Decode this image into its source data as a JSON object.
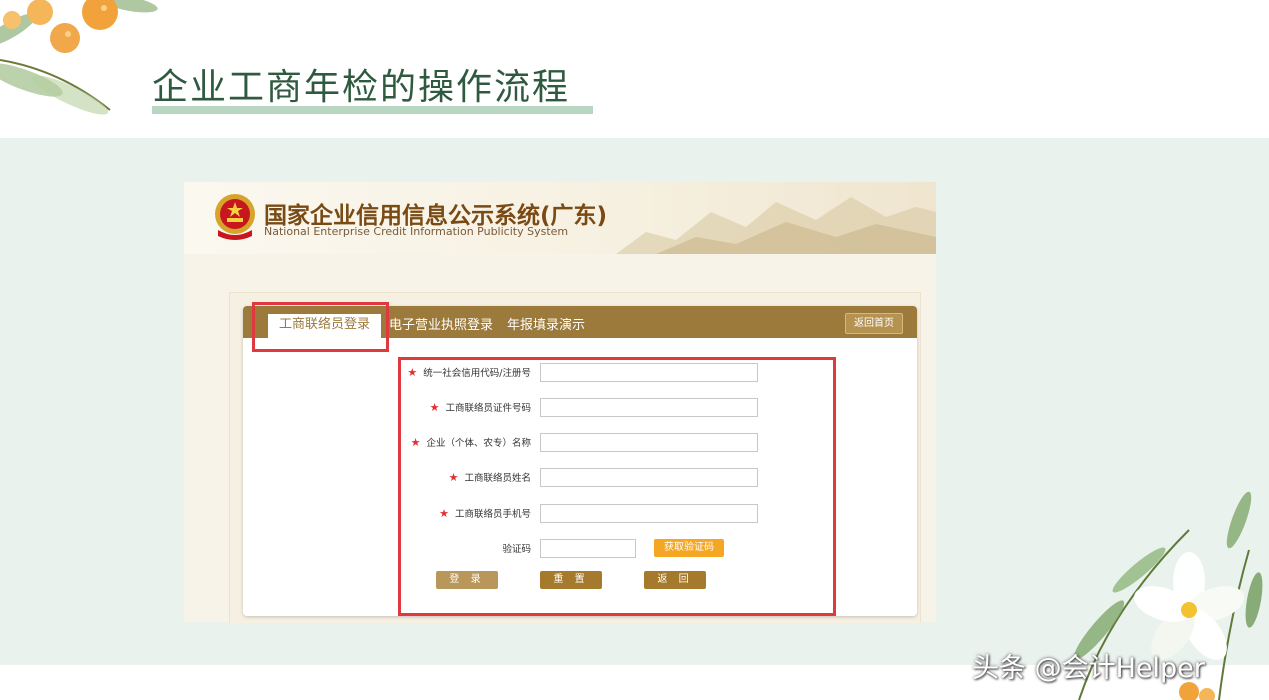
{
  "slide": {
    "title": "企业工商年检的操作流程",
    "watermark": "头条 @会计Helper"
  },
  "system": {
    "title": "国家企业信用信息公示系统(广东)",
    "subtitle": "National Enterprise Credit Information Publicity System",
    "emblem_icon": "national-emblem-icon"
  },
  "tabs": [
    {
      "label": "工商联络员登录",
      "active": true
    },
    {
      "label": "电子营业执照登录",
      "active": false
    },
    {
      "label": "年报填录演示",
      "active": false
    }
  ],
  "home_button": "返回首页",
  "form": {
    "fields": [
      {
        "label": "统一社会信用代码/注册号",
        "required": true,
        "value": ""
      },
      {
        "label": "工商联络员证件号码",
        "required": true,
        "value": ""
      },
      {
        "label": "企业（个体、农专）名称",
        "required": true,
        "value": ""
      },
      {
        "label": "工商联络员姓名",
        "required": true,
        "value": ""
      },
      {
        "label": "工商联络员手机号",
        "required": true,
        "value": ""
      }
    ],
    "captcha_label": "验证码",
    "captcha_value": "",
    "get_code_button": "获取验证码",
    "required_mark": "★",
    "buttons": {
      "login": "登 录",
      "reset": "重 置",
      "back": "返 回"
    }
  },
  "colors": {
    "accent_brown": "#9c7a3c",
    "highlight_red": "#e0383f",
    "captcha_orange": "#f5a623",
    "title_green": "#2f5a3f"
  }
}
